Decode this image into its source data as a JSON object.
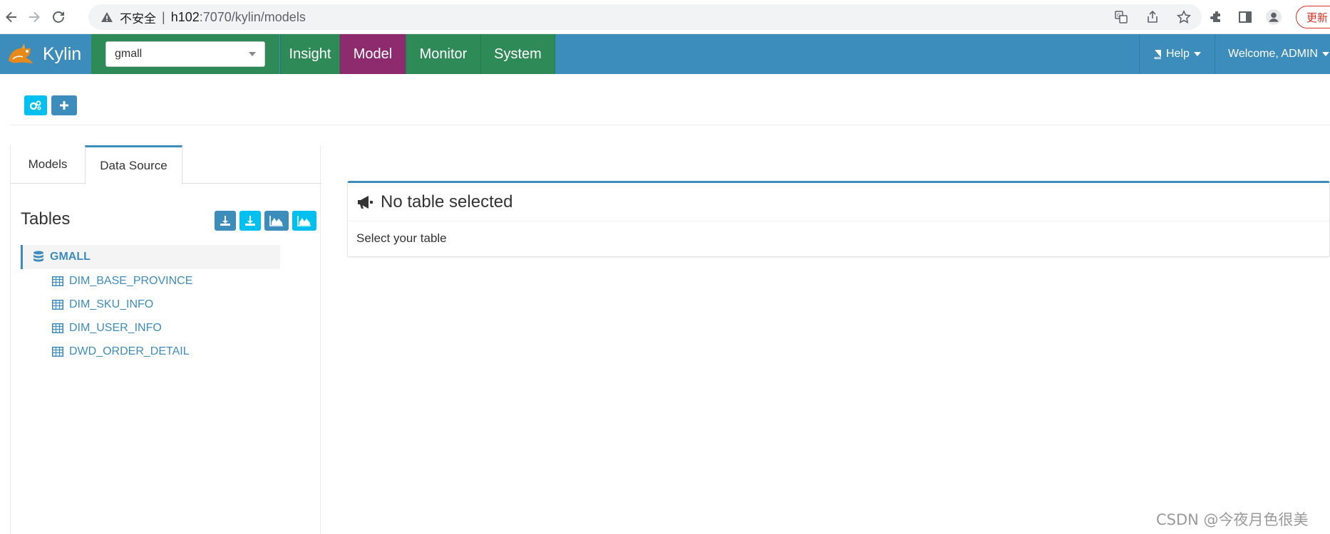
{
  "browser": {
    "insecure_label": "不安全",
    "separator": "|",
    "url_host": "h102",
    "url_path": ":7070/kylin/models",
    "update_label": "更新"
  },
  "navbar": {
    "brand": "Kylin",
    "project": "gmall",
    "menu": [
      {
        "label": "Insight",
        "active": false
      },
      {
        "label": "Model",
        "active": true
      },
      {
        "label": "Monitor",
        "active": false
      },
      {
        "label": "System",
        "active": false
      }
    ],
    "help": "Help",
    "welcome": "Welcome, ADMIN"
  },
  "tabs": {
    "models": "Models",
    "data_source": "Data Source"
  },
  "tables_panel": {
    "title": "Tables",
    "database": "GMALL",
    "tables": [
      "DIM_BASE_PROVINCE",
      "DIM_SKU_INFO",
      "DIM_USER_INFO",
      "DWD_ORDER_DETAIL"
    ]
  },
  "info": {
    "title": "No table selected",
    "body": "Select your table"
  },
  "watermark": "CSDN @今夜月色很美",
  "colors": {
    "primary": "#3c8dbc",
    "green": "#2e8a57",
    "active_menu": "#8e2a6e",
    "info_btn": "#00c0ef",
    "blue_btn": "#3c8dbc"
  }
}
